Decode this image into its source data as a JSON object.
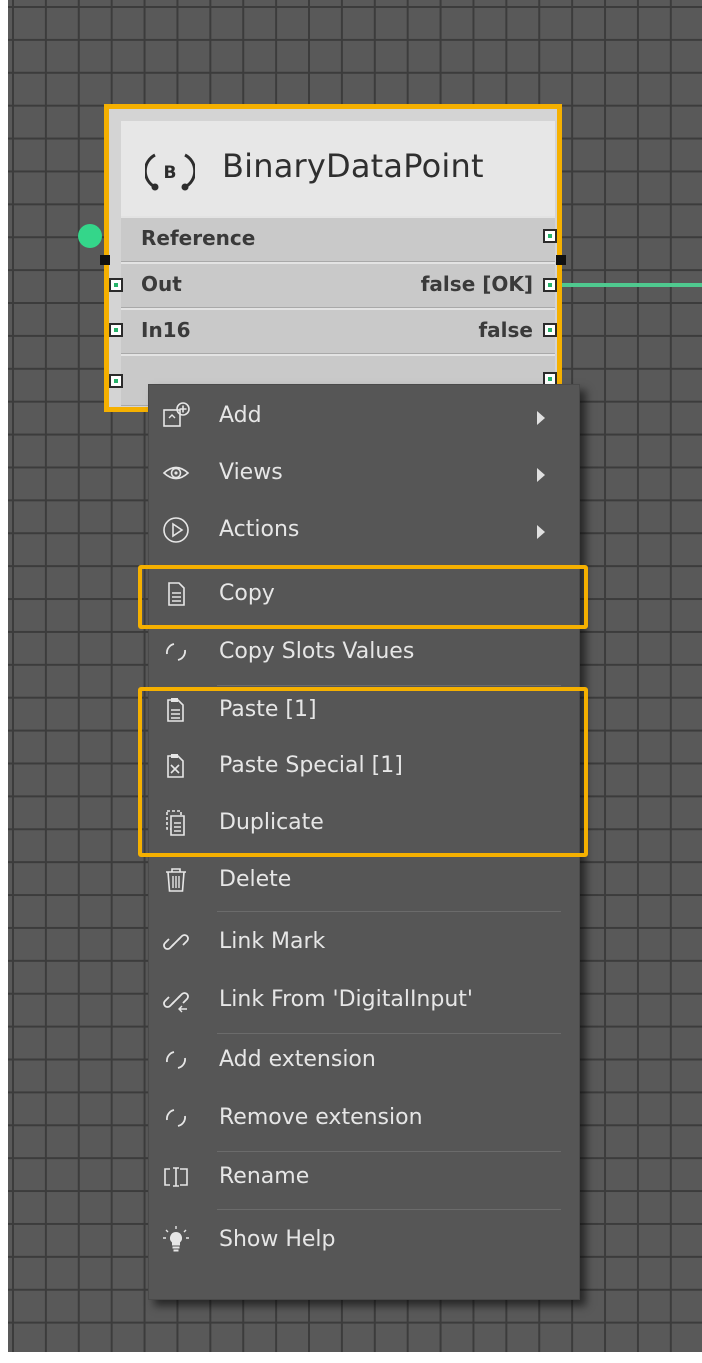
{
  "node": {
    "title": "BinaryDataPoint",
    "icon": "binary-datapoint-icon",
    "slots": [
      {
        "name": "Reference",
        "value": ""
      },
      {
        "name": "Out",
        "value": "false [OK]"
      },
      {
        "name": "In16",
        "value": "false"
      },
      {
        "name": "",
        "value": ""
      }
    ]
  },
  "menu": {
    "items": [
      {
        "label": "Add",
        "icon": "add-component-icon",
        "submenu": true
      },
      {
        "label": "Views",
        "icon": "eye-icon",
        "submenu": true
      },
      {
        "label": "Actions",
        "icon": "play-circle-icon",
        "submenu": true
      },
      {
        "label": "Copy",
        "icon": "copy-icon",
        "submenu": false
      },
      {
        "label": "Copy Slots Values",
        "icon": "spinner-icon",
        "submenu": false
      },
      {
        "label": "Paste [1]",
        "icon": "paste-icon",
        "submenu": false
      },
      {
        "label": "Paste Special [1]",
        "icon": "paste-special-icon",
        "submenu": false
      },
      {
        "label": "Duplicate",
        "icon": "duplicate-icon",
        "submenu": false
      },
      {
        "label": "Delete",
        "icon": "trash-icon",
        "submenu": false
      },
      {
        "label": "Link Mark",
        "icon": "link-icon",
        "submenu": false
      },
      {
        "label": "Link From 'DigitalInput'",
        "icon": "link-from-icon",
        "submenu": false
      },
      {
        "label": "Add extension",
        "icon": "spinner-icon",
        "submenu": false
      },
      {
        "label": "Remove extension",
        "icon": "spinner-icon",
        "submenu": false
      },
      {
        "label": "Rename",
        "icon": "rename-icon",
        "submenu": false
      },
      {
        "label": "Show Help",
        "icon": "lightbulb-icon",
        "submenu": false
      }
    ]
  },
  "colors": {
    "highlight": "#f5b000",
    "link": "#4fc98f",
    "menu_bg": "#565656",
    "grid_bg": "#595959"
  }
}
